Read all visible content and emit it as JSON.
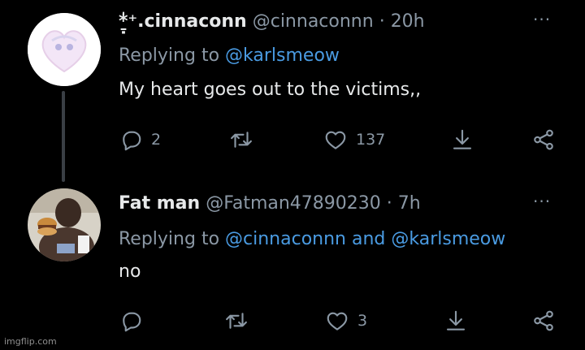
{
  "tweets": [
    {
      "display_name": "*̱̣̍⁺.cinnaconn",
      "handle": "@cinnaconnn",
      "separator": "·",
      "time": "20h",
      "reply_prefix": "Replying to ",
      "reply_mentions": [
        "@karlsmeow"
      ],
      "reply_joiner": "",
      "text": "My heart goes out to the victims,,",
      "reply_count": "2",
      "retweet_count": "",
      "like_count": "137"
    },
    {
      "display_name": "Fat man",
      "handle": "@Fatman47890230",
      "separator": "·",
      "time": "7h",
      "reply_prefix": "Replying to ",
      "reply_mentions": [
        "@cinnaconnn",
        "@karlsmeow"
      ],
      "reply_joiner": " and ",
      "text": "no",
      "reply_count": "",
      "retweet_count": "",
      "like_count": "3"
    }
  ],
  "more_label": "···",
  "watermark": "imgflip.com",
  "colors": {
    "background": "#000000",
    "text": "#e7e9ea",
    "muted": "#8b98a5",
    "link": "#4a9be2"
  },
  "icons": [
    "reply-icon",
    "retweet-icon",
    "like-icon",
    "download-icon",
    "share-icon",
    "more-icon"
  ]
}
